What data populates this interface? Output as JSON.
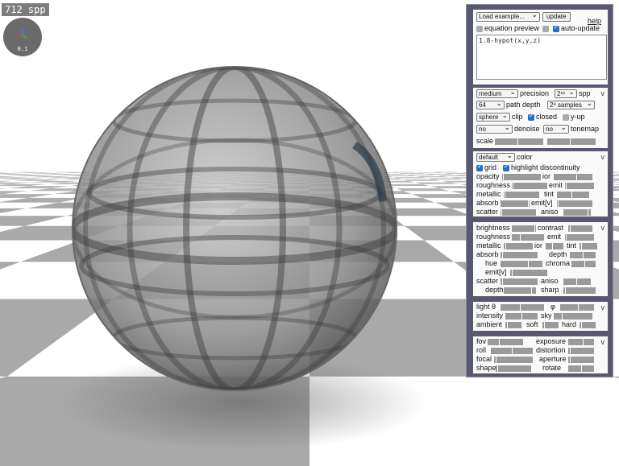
{
  "status": {
    "spp_text": "712 spp",
    "gizmo_scale": "0.1"
  },
  "top": {
    "example_select": "Load example...",
    "update_button": "update",
    "help_link": "help",
    "equation_preview_label": "equation preview",
    "equation_preview_checked": false,
    "auto_update_label": "auto-update",
    "auto_update_checked": true,
    "equation": "1.8-hypot(x,y,z)"
  },
  "render": {
    "precision_select": "medium",
    "precision_label": "precision",
    "spp_select": "2¹⁶",
    "spp_label": "spp",
    "path_depth_select": "64",
    "path_depth_label": "path depth",
    "samples_select": "2⁸ samples",
    "clip_select": "sphere",
    "clip_label": "clip",
    "closed_label": "closed",
    "closed_checked": true,
    "yup_label": "y-up",
    "yup_checked": false,
    "denoise_select": "no",
    "denoise_label": "denoise",
    "tonemap_select": "no",
    "tonemap_label": "tonemap",
    "scale_label": "scale",
    "collapse": "v"
  },
  "color": {
    "color_select": "default",
    "color_label": "color",
    "grid_label": "grid",
    "grid_checked": true,
    "highlight_label": "highlight discontinuity",
    "highlight_checked": true,
    "opacity": "opacity",
    "ior": "ior",
    "roughness": "roughness",
    "emit": "emit",
    "metallic": "metallic",
    "tint": "tint",
    "absorb": "absorb",
    "emitv": "emit[v]",
    "scatter": "scatter",
    "aniso": "aniso",
    "collapse": "v"
  },
  "material2": {
    "brightness": "brightness",
    "contrast": "contrast",
    "roughness": "roughness",
    "emit": "emit",
    "metallic": "metallic",
    "ior": "ior",
    "tint": "tint",
    "absorb": "absorb",
    "depth": "depth",
    "hue": "hue",
    "chroma": "chroma",
    "emitv": "emit[v]",
    "scatter": "scatter",
    "aniso": "aniso",
    "depth2": "depth",
    "sharp": "sharp",
    "collapse": "v"
  },
  "light": {
    "light": "light θ",
    "phi": "φ",
    "intensity": "intensity",
    "sky": "sky",
    "ambient": "ambient",
    "soft": "soft",
    "hard": "hard",
    "collapse": "v"
  },
  "camera": {
    "fov": "fov",
    "exposure": "exposure",
    "roll": "roll",
    "distortion": "distortion",
    "focal": "focal",
    "aperture": "aperture",
    "shape": "shape",
    "rotate": "rotate",
    "collapse": "v"
  },
  "colors": {
    "panel": "#585870",
    "checkbox_on": "#1e6fd0",
    "slider": "#9a9a9a"
  }
}
